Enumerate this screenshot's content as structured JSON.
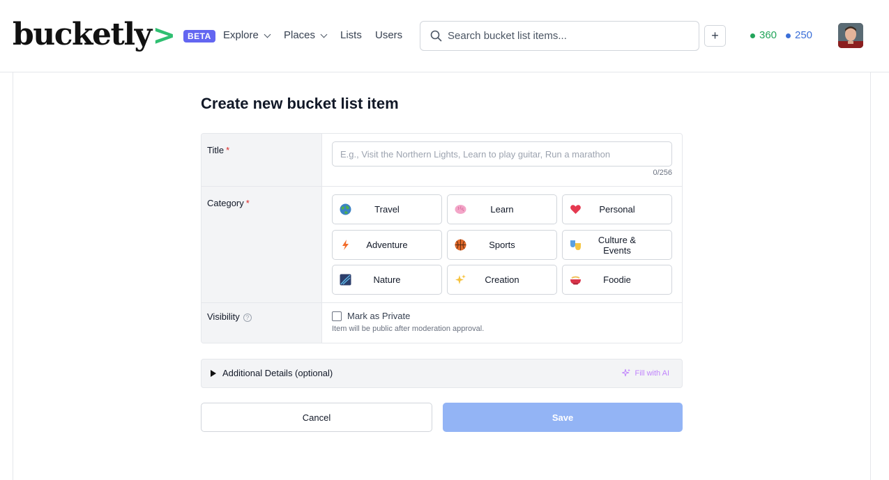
{
  "header": {
    "logo_text": "bucketly",
    "logo_chevron": ">",
    "beta_badge": "BETA",
    "nav": [
      {
        "label": "Explore",
        "has_dropdown": true
      },
      {
        "label": "Places",
        "has_dropdown": true
      },
      {
        "label": "Lists",
        "has_dropdown": false
      },
      {
        "label": "Users",
        "has_dropdown": false
      }
    ],
    "search_placeholder": "Search bucket list items...",
    "add_label": "+",
    "stats": [
      {
        "value": "360",
        "color": "#22a45a"
      },
      {
        "value": "250",
        "color": "#3b6fd8"
      }
    ]
  },
  "page": {
    "title": "Create new bucket list item"
  },
  "form": {
    "title_field": {
      "label": "Title",
      "required_mark": "*",
      "placeholder": "E.g., Visit the Northern Lights, Learn to play guitar, Run a marathon",
      "value": "",
      "counter": "0/256"
    },
    "category": {
      "label": "Category",
      "required_mark": "*",
      "options": [
        {
          "label": "Travel",
          "icon": "globe-icon"
        },
        {
          "label": "Learn",
          "icon": "brain-icon"
        },
        {
          "label": "Personal",
          "icon": "heart-icon"
        },
        {
          "label": "Adventure",
          "icon": "lightning-icon"
        },
        {
          "label": "Sports",
          "icon": "basketball-icon"
        },
        {
          "label": "Culture & Events",
          "icon": "theater-masks-icon"
        },
        {
          "label": "Nature",
          "icon": "nature-icon"
        },
        {
          "label": "Creation",
          "icon": "sparkles-icon"
        },
        {
          "label": "Foodie",
          "icon": "ramen-bowl-icon"
        }
      ]
    },
    "visibility": {
      "label": "Visibility",
      "help_icon": "?",
      "checkbox_label": "Mark as Private",
      "checked": false,
      "help_text": "Item will be public after moderation approval."
    },
    "additional_details": {
      "label": "Additional Details (optional)",
      "ai_label": "Fill with AI"
    },
    "actions": {
      "cancel": "Cancel",
      "save": "Save"
    }
  },
  "colors": {
    "brand_green": "#2fbf71",
    "beta_purple": "#6366f1",
    "save_disabled": "#93b4f5",
    "required_red": "#dc2626"
  }
}
